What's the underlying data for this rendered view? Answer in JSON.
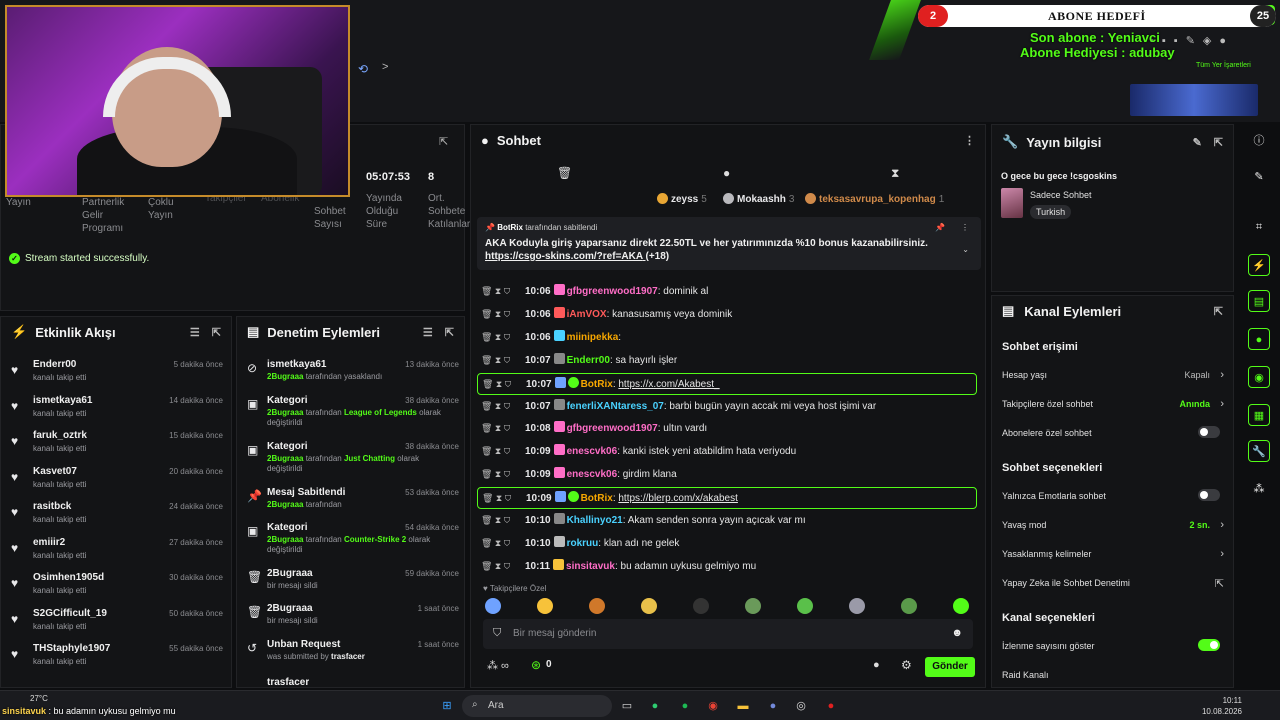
{
  "overlay": {
    "goal_title": "ABONE HEDEFİ",
    "goal_left": "2",
    "goal_right": "25",
    "last_sub": "Son abone : Yeniavci",
    "last_gift": "Abone Hediyesi : adubay",
    "bookmarks": "Tüm Yer İşaretleri"
  },
  "stats": {
    "labels": [
      "Yayın",
      "Partnerlik Gelir Programı",
      "Çoklu Yayın",
      "Takipçiler",
      "Abonelik",
      "Sohbet Sayısı",
      "Yayında Olduğu Süre",
      "Ort. Sohbete Katılanlar"
    ],
    "duration": "05:07:53",
    "avg_chatters": "8",
    "toast": "Stream started successfully."
  },
  "activity": {
    "title": "Etkinlik Akışı",
    "items": [
      {
        "name": "Enderr00",
        "action": "kanalı takip etti",
        "time": "5 dakika önce"
      },
      {
        "name": "ismetkaya61",
        "action": "kanalı takip etti",
        "time": "14 dakika önce"
      },
      {
        "name": "faruk_oztrk",
        "action": "kanalı takip etti",
        "time": "15 dakika önce"
      },
      {
        "name": "Kasvet07",
        "action": "kanalı takip etti",
        "time": "20 dakika önce"
      },
      {
        "name": "rasitbck",
        "action": "kanalı takip etti",
        "time": "24 dakika önce"
      },
      {
        "name": "emiiir2",
        "action": "kanalı takip etti",
        "time": "27 dakika önce"
      },
      {
        "name": "Osimhen1905d",
        "action": "kanalı takip etti",
        "time": "30 dakika önce"
      },
      {
        "name": "S2GCifficult_19",
        "action": "kanalı takip etti",
        "time": "50 dakika önce"
      },
      {
        "name": "THStaphyle1907",
        "action": "kanalı takip etti",
        "time": "55 dakika önce"
      }
    ]
  },
  "audit": {
    "title": "Denetim Eylemleri",
    "items": [
      {
        "title": "ismetkaya61",
        "actor": "2Bugraaa",
        "mid": " tarafından yasaklandı",
        "target": "",
        "tail": "",
        "time": "13 dakika önce"
      },
      {
        "title": "Kategori",
        "actor": "2Bugraaa",
        "mid": " tarafından ",
        "target": "League of Legends",
        "tail": " olarak değiştirildi",
        "time": "38 dakika önce"
      },
      {
        "title": "Kategori",
        "actor": "2Bugraaa",
        "mid": " tarafından ",
        "target": "Just Chatting",
        "tail": " olarak değiştirildi",
        "time": "38 dakika önce"
      },
      {
        "title": "Mesaj Sabitlendi",
        "actor": "2Bugraaa",
        "mid": " tarafından",
        "target": "",
        "tail": "",
        "time": "53 dakika önce"
      },
      {
        "title": "Kategori",
        "actor": "2Bugraaa",
        "mid": " tarafından ",
        "target": "Counter-Strike 2",
        "tail": " olarak değiştirildi",
        "time": "54 dakika önce"
      },
      {
        "title": "2Bugraaa",
        "actor": "",
        "mid": "bir mesajı sildi",
        "target": "",
        "tail": "",
        "time": "59 dakika önce"
      },
      {
        "title": "2Bugraaa",
        "actor": "",
        "mid": "bir mesajı sildi",
        "target": "",
        "tail": "",
        "time": "1 saat önce"
      },
      {
        "title": "Unban Request",
        "actor": "",
        "mid": "was submitted by ",
        "target": "trasfacer",
        "tail": "",
        "time": "1 saat önce"
      }
    ],
    "cut_item": "trasfacer"
  },
  "chat": {
    "title": "Sohbet",
    "leaders": [
      {
        "name": "zeyss",
        "count": "5",
        "color": "#e8a634"
      },
      {
        "name": "Mokaashh",
        "count": "3",
        "color": "#b9b9bd"
      },
      {
        "name": "teksasavrupa_kopenhag",
        "count": "1",
        "color": "#d08a4a"
      }
    ],
    "pinned": {
      "by": "BotRix",
      "by_suffix": " tarafından sabitlendi",
      "text": "AKA Koduyla giriş yaparsanız direkt 22.50TL ve her yatırımınızda %10 bonus kazanabilirsiniz.",
      "link": "https://csgo-skins.com/?ref=AKA",
      "extra": "(+18)"
    },
    "messages": [
      {
        "time": "10:06",
        "user": "gfbgreenwood1907",
        "color": "#ff6ec7",
        "text": "dominik al",
        "hl": false
      },
      {
        "time": "10:06",
        "user": "iAmVOX",
        "color": "#ff5a5a",
        "text": "kanasusamış veya dominik",
        "hl": false
      },
      {
        "time": "10:06",
        "user": "miinipekka",
        "color": "#f7a700",
        "text": "",
        "hl": false
      },
      {
        "time": "10:07",
        "user": "Enderr00",
        "color": "#53fc18",
        "text": "sa hayırlı işler",
        "hl": false
      },
      {
        "time": "10:07",
        "user": "BotRix",
        "color": "#f7a700",
        "text": "https://x.com/Akabest_",
        "hl": true
      },
      {
        "time": "10:07",
        "user": "fenerliXANtaress_07",
        "color": "#4ad2ff",
        "text": "barbi bugün yayın accak mi veya host işimi var",
        "hl": false
      },
      {
        "time": "10:08",
        "user": "gfbgreenwood1907",
        "color": "#ff6ec7",
        "text": "ultın vardı",
        "hl": false
      },
      {
        "time": "10:09",
        "user": "enescvk06",
        "color": "#ff6ec7",
        "text": "kanki istek yeni atabildim hata veriyodu",
        "hl": false
      },
      {
        "time": "10:09",
        "user": "enescvk06",
        "color": "#ff6ec7",
        "text": "girdim klana",
        "hl": false
      },
      {
        "time": "10:09",
        "user": "BotRix",
        "color": "#f7a700",
        "text": "https://blerp.com/x/akabest",
        "hl": true
      },
      {
        "time": "10:10",
        "user": "Khallinyo21",
        "color": "#4ad2ff",
        "text": "Akam senden sonra yayın açıcak var mı",
        "hl": false
      },
      {
        "time": "10:10",
        "user": "rokruu",
        "color": "#4ad2ff",
        "text": "klan adı ne gelek",
        "hl": false
      },
      {
        "time": "10:11",
        "user": "sinsitavuk",
        "color": "#ff6ec7",
        "text": "bu adamın uykusu gelmiyo mu",
        "hl": false
      }
    ],
    "emotes_label": "Takipçilere Özel",
    "input_placeholder": "Bir mesaj gönderin",
    "points": "0",
    "send": "Gönder"
  },
  "info": {
    "title": "Yayın bilgisi",
    "stream_title": "O gece bu gece !csgoskins",
    "category": "Sadece Sohbet",
    "language": "Turkish"
  },
  "actions": {
    "title": "Kanal Eylemleri",
    "sec1": "Sohbet erişimi",
    "account_age": "Hesap yaşı",
    "account_age_val": "Kapalı",
    "followers_only": "Takipçilere özel sohbet",
    "followers_only_val": "Anında",
    "subs_only": "Abonelere özel sohbet",
    "sec2": "Sohbet seçenekleri",
    "emote_only": "Yalnızca Emotlarla sohbet",
    "slow_mode": "Yavaş mod",
    "slow_mode_val": "2 sn.",
    "banned_words": "Yasaklanmış kelimeler",
    "ai_mod": "Yapay Zeka ile Sohbet Denetimi",
    "sec3": "Kanal seçenekleri",
    "show_viewers": "İzlenme sayısını göster",
    "raid": "Raid Kanalı"
  },
  "taskbar": {
    "weather": "27°C",
    "search": "Ara",
    "time": "10:11",
    "date": "10.08.2026"
  },
  "ticker": {
    "user": "sinsitavuk",
    "text": " : bu adamın uykusu gelmiyo mu"
  },
  "colors": {
    "accent": "#53fc18",
    "panel": "#131416",
    "bg": "#0d0e10"
  }
}
